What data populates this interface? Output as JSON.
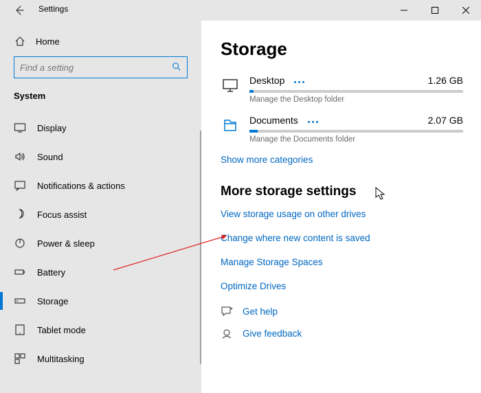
{
  "window": {
    "title": "Settings"
  },
  "sidebar": {
    "home": "Home",
    "search_placeholder": "Find a setting",
    "group": "System",
    "items": [
      {
        "label": "Display"
      },
      {
        "label": "Sound"
      },
      {
        "label": "Notifications & actions"
      },
      {
        "label": "Focus assist"
      },
      {
        "label": "Power & sleep"
      },
      {
        "label": "Battery"
      },
      {
        "label": "Storage"
      },
      {
        "label": "Tablet mode"
      },
      {
        "label": "Multitasking"
      }
    ],
    "selected_index": 6
  },
  "page": {
    "title": "Storage",
    "items": [
      {
        "name": "Desktop",
        "size": "1.26 GB",
        "sub": "Manage the Desktop folder",
        "fill_pct": 2
      },
      {
        "name": "Documents",
        "size": "2.07 GB",
        "sub": "Manage the Documents folder",
        "fill_pct": 4
      }
    ],
    "show_more": "Show more categories",
    "more_header": "More storage settings",
    "more_links": [
      "View storage usage on other drives",
      "Change where new content is saved",
      "Manage Storage Spaces",
      "Optimize Drives"
    ],
    "help": "Get help",
    "feedback": "Give feedback"
  }
}
